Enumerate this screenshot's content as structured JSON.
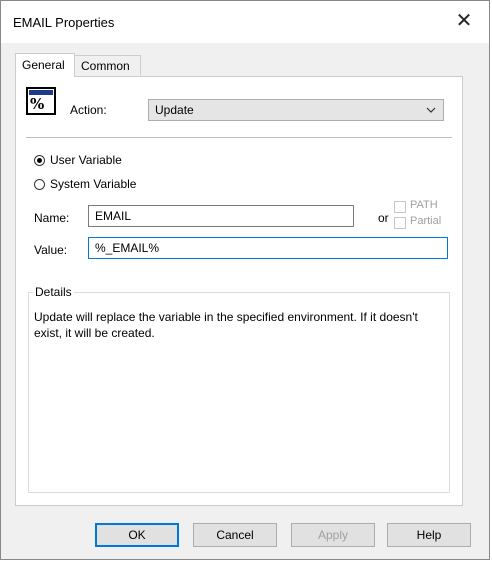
{
  "window": {
    "title": "EMAIL Properties",
    "close_label": "✕"
  },
  "tabs": [
    {
      "label": "General",
      "active": true
    },
    {
      "label": "Common",
      "active": false
    }
  ],
  "action": {
    "label": "Action:",
    "value": "Update",
    "icon_name": "environment-variable-icon",
    "icon_glyph": "%"
  },
  "variable_type": {
    "options": [
      {
        "label": "User Variable",
        "checked": true
      },
      {
        "label": "System Variable",
        "checked": false
      }
    ]
  },
  "name": {
    "label": "Name:",
    "value": "EMAIL",
    "or_label": "or"
  },
  "value": {
    "label": "Value:",
    "value": "%_EMAIL%"
  },
  "path_checkbox": {
    "label": "PATH",
    "enabled": false
  },
  "partial_checkbox": {
    "label": "Partial",
    "enabled": false
  },
  "details": {
    "legend": "Details",
    "text": "Update will replace the variable in the specified environment. If it doesn't exist, it will be created."
  },
  "buttons": {
    "ok": "OK",
    "cancel": "Cancel",
    "apply": "Apply",
    "help": "Help"
  },
  "colors": {
    "focus_border": "#0078d7",
    "panel_bg": "#f0f0f0"
  }
}
